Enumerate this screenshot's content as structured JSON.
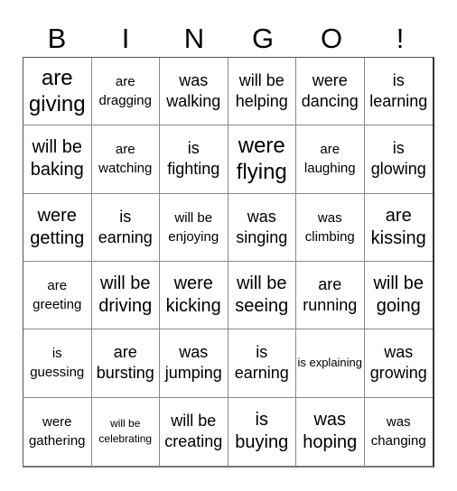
{
  "header": [
    "B",
    "I",
    "N",
    "G",
    "O",
    "!"
  ],
  "rows": [
    [
      {
        "text": "are giving",
        "size": "xl"
      },
      {
        "text": "are dragging",
        "size": "s"
      },
      {
        "text": "was walking",
        "size": "m"
      },
      {
        "text": "will be helping",
        "size": "m"
      },
      {
        "text": "were dancing",
        "size": "m"
      },
      {
        "text": "is learning",
        "size": "m"
      }
    ],
    [
      {
        "text": "will be baking",
        "size": "l"
      },
      {
        "text": "are watching",
        "size": "s"
      },
      {
        "text": "is fighting",
        "size": "m"
      },
      {
        "text": "were flying",
        "size": "xl"
      },
      {
        "text": "are laughing",
        "size": "s"
      },
      {
        "text": "is glowing",
        "size": "m"
      }
    ],
    [
      {
        "text": "were getting",
        "size": "l"
      },
      {
        "text": "is earning",
        "size": "m"
      },
      {
        "text": "will be enjoying",
        "size": "s"
      },
      {
        "text": "was singing",
        "size": "m"
      },
      {
        "text": "was climbing",
        "size": "s"
      },
      {
        "text": "are kissing",
        "size": "l"
      }
    ],
    [
      {
        "text": "are greeting",
        "size": "s"
      },
      {
        "text": "will be driving",
        "size": "l"
      },
      {
        "text": "were kicking",
        "size": "l"
      },
      {
        "text": "will be seeing",
        "size": "l"
      },
      {
        "text": "are running",
        "size": "m"
      },
      {
        "text": "will be going",
        "size": "l"
      }
    ],
    [
      {
        "text": "is guessing",
        "size": "s"
      },
      {
        "text": "are bursting",
        "size": "m"
      },
      {
        "text": "was jumping",
        "size": "m"
      },
      {
        "text": "is earning",
        "size": "m"
      },
      {
        "text": "is explaining",
        "size": "xs"
      },
      {
        "text": "was growing",
        "size": "m"
      }
    ],
    [
      {
        "text": "were gathering",
        "size": "s"
      },
      {
        "text": "will be celebrating",
        "size": "xxs"
      },
      {
        "text": "will be creating",
        "size": "m"
      },
      {
        "text": "is buying",
        "size": "l"
      },
      {
        "text": "was hoping",
        "size": "l"
      },
      {
        "text": "was changing",
        "size": "s"
      }
    ]
  ]
}
